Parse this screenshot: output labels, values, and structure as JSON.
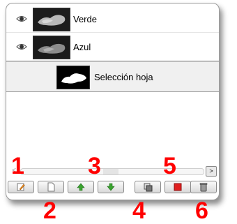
{
  "layers": [
    {
      "name": "Verde",
      "visible": true,
      "icon": "eye-icon",
      "thumbnail": "green-channel-thumbnail"
    },
    {
      "name": "Azul",
      "visible": true,
      "icon": "eye-icon",
      "thumbnail": "blue-channel-thumbnail"
    },
    {
      "name": "Selección hoja",
      "visible": false,
      "selected": true,
      "thumbnail": "leaf-mask-thumbnail"
    }
  ],
  "scrollbar": {
    "left_arrow": "<",
    "right_arrow": ">",
    "position": 0.45
  },
  "toolbar": {
    "buttons": [
      {
        "icon": "edit-icon"
      },
      {
        "icon": "new-channel-icon"
      },
      {
        "icon": "raise-icon",
        "color": "#3aa32f"
      },
      {
        "icon": "lower-icon",
        "color": "#3aa32f"
      },
      {
        "icon": "duplicate-icon"
      },
      {
        "icon": "to-selection-icon",
        "color": "#e02020"
      },
      {
        "icon": "delete-icon"
      }
    ]
  },
  "callouts": [
    "1",
    "2",
    "3",
    "4",
    "5",
    "6"
  ],
  "colors": {
    "callout": "#ff0000",
    "selected_row": "#f0f0f0"
  }
}
